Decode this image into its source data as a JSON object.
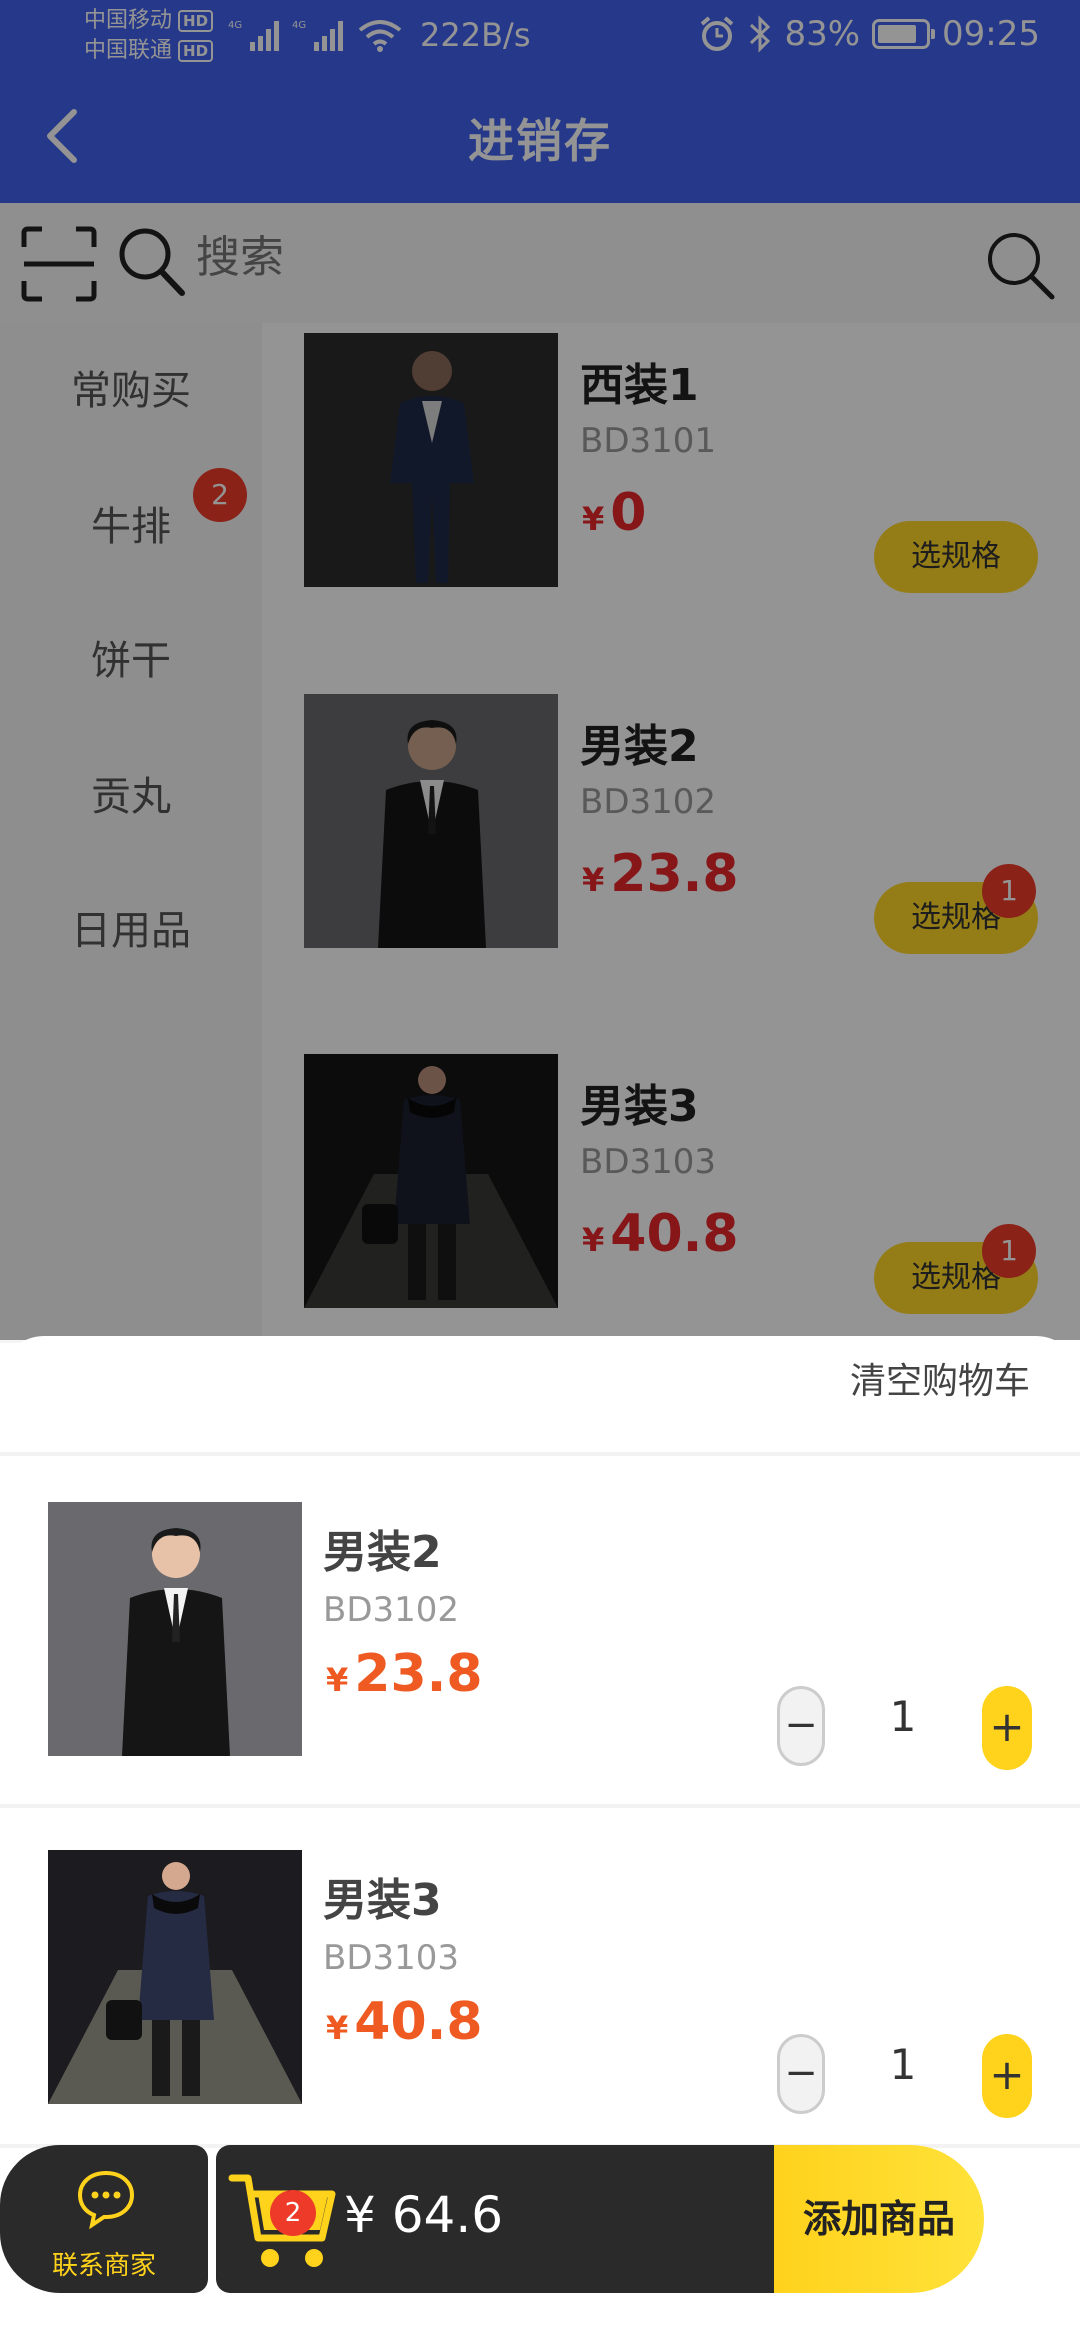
{
  "status_bar": {
    "carrier_1": "中国移动",
    "carrier_2": "中国联通",
    "hd": "HD",
    "net": "4G",
    "speed": "222B/s",
    "battery": "83%",
    "time": "09:25"
  },
  "header": {
    "title": "进销存",
    "back_icon": "chevron-left-icon"
  },
  "search": {
    "placeholder": "搜索"
  },
  "categories": [
    {
      "label": "常购买"
    },
    {
      "label": "牛排",
      "badge": "2"
    },
    {
      "label": "饼干"
    },
    {
      "label": "贡丸"
    },
    {
      "label": "日用品"
    }
  ],
  "products": [
    {
      "name": "西装1",
      "code": "BD3101",
      "currency": "¥",
      "price": "0",
      "spec_label": "选规格"
    },
    {
      "name": "男装2",
      "code": "BD3102",
      "currency": "¥",
      "price": "23.8",
      "spec_label": "选规格",
      "badge": "1"
    },
    {
      "name": "男装3",
      "code": "BD3103",
      "currency": "¥",
      "price": "40.8",
      "spec_label": "选规格",
      "badge": "1"
    }
  ],
  "cart": {
    "clear_label": "清空购物车",
    "items": [
      {
        "name": "男装2",
        "code": "BD3102",
        "currency": "¥",
        "price": "23.8",
        "qty": "1",
        "minus": "−",
        "plus": "+"
      },
      {
        "name": "男装3",
        "code": "BD3103",
        "currency": "¥",
        "price": "40.8",
        "qty": "1",
        "minus": "−",
        "plus": "+"
      }
    ]
  },
  "bottom_bar": {
    "contact_label": "联系商家",
    "cart_count": "2",
    "total": "¥ 64.6",
    "add_label": "添加商品"
  },
  "colors": {
    "header": "#4161ee",
    "accent_yellow": "#ffd21c",
    "price_red": "#e8262b",
    "badge_red": "#ee3b29"
  }
}
